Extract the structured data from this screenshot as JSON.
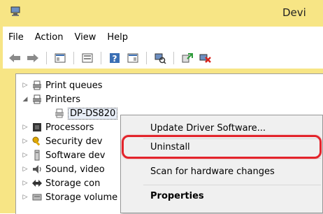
{
  "window": {
    "title": "Devi"
  },
  "menu": [
    "File",
    "Action",
    "View",
    "Help"
  ],
  "tree": {
    "items": [
      {
        "label": "Print queues",
        "icon": "print-queue-icon",
        "expanded": false
      },
      {
        "label": "Printers",
        "icon": "printer-icon",
        "expanded": true
      },
      {
        "label": "DP-DS820",
        "icon": "printer-device-icon",
        "child": true
      },
      {
        "label": "Processors",
        "icon": "processor-icon",
        "expanded": false
      },
      {
        "label": "Security dev",
        "icon": "security-device-icon",
        "expanded": false
      },
      {
        "label": "Software dev",
        "icon": "software-device-icon",
        "expanded": false
      },
      {
        "label": "Sound, video",
        "icon": "sound-icon",
        "expanded": false
      },
      {
        "label": "Storage con",
        "icon": "storage-controller-icon",
        "expanded": false
      },
      {
        "label": "Storage volume shadow copies",
        "icon": "storage-volume-icon",
        "expanded": false
      }
    ]
  },
  "context_menu": {
    "update": "Update Driver Software...",
    "uninstall": "Uninstall",
    "scan": "Scan for hardware changes",
    "properties": "Properties"
  },
  "colors": {
    "highlight_ring": "#e3242b",
    "frame": "#f7e585"
  }
}
